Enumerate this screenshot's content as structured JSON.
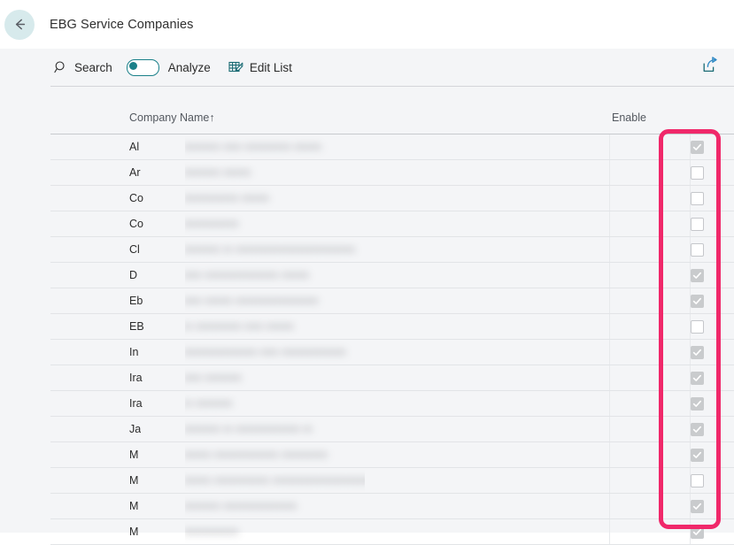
{
  "titlebar": {
    "back_icon": "arrow-left-icon",
    "title": "EBG Service Companies"
  },
  "toolbar": {
    "search_label": "Search",
    "search_icon": "search-icon",
    "analyze_label": "Analyze",
    "analyze_toggle_state": "off",
    "edit_list_label": "Edit List",
    "edit_list_icon": "edit-list-icon",
    "share_icon": "share-export-icon"
  },
  "table": {
    "columns": [
      {
        "key": "company_name",
        "label": "Company Name",
        "sort_indicator": "↑"
      },
      {
        "key": "enable",
        "label": "Enable"
      }
    ],
    "rows": [
      {
        "name_prefix": "Al",
        "name_redacted": "mmmm mm mmmmm mmm",
        "enable": true
      },
      {
        "name_prefix": "Ar",
        "name_redacted": "mmmm mmm",
        "enable": false
      },
      {
        "name_prefix": "Co",
        "name_redacted": "mmmmmm mmm",
        "enable": false
      },
      {
        "name_prefix": "Co",
        "name_redacted": "mmmmmm",
        "enable": false
      },
      {
        "name_prefix": "Cl",
        "name_redacted": "mmmm m mmmmmmmmmmmmm",
        "enable": false
      },
      {
        "name_prefix": "D",
        "name_redacted": "mm mmmmmmmm mmm",
        "enable": true
      },
      {
        "name_prefix": "Eb",
        "name_redacted": "mm mmm mmmmmmmmm",
        "enable": true
      },
      {
        "name_prefix": "EB",
        "name_redacted": "m mmmmm mm mmm",
        "enable": false
      },
      {
        "name_prefix": "In",
        "name_redacted": "mmmmmmmm mm   mmmmmmm",
        "enable": true
      },
      {
        "name_prefix": "Ira",
        "name_redacted": "mm mmmm",
        "enable": true
      },
      {
        "name_prefix": "Ira",
        "name_redacted": "m mmmm",
        "enable": true
      },
      {
        "name_prefix": "Ja",
        "name_redacted": "mmmm m mmmmmmm m",
        "enable": true
      },
      {
        "name_prefix": "M",
        "name_redacted": "mmm mmmmmmm mmmmm",
        "enable": true
      },
      {
        "name_prefix": "M",
        "name_redacted": "mmm mmmmmm mmmmmmmmmmm",
        "enable": false
      },
      {
        "name_prefix": "M",
        "name_redacted": "mmmm mmmmmmmm",
        "enable": true
      },
      {
        "name_prefix": "M",
        "name_redacted": "mmmmmm",
        "enable": true
      }
    ]
  },
  "annotation": {
    "type": "highlight-rectangle",
    "target": "enable-column",
    "color": "#f0286a"
  },
  "colors": {
    "accent_teal": "#1a8089",
    "page_background": "#f4f5f7",
    "titlebar_background": "#ffffff",
    "back_button_background": "#d7eaec",
    "grid_line": "#e2e4e7",
    "annotation_pink": "#f0286a"
  }
}
